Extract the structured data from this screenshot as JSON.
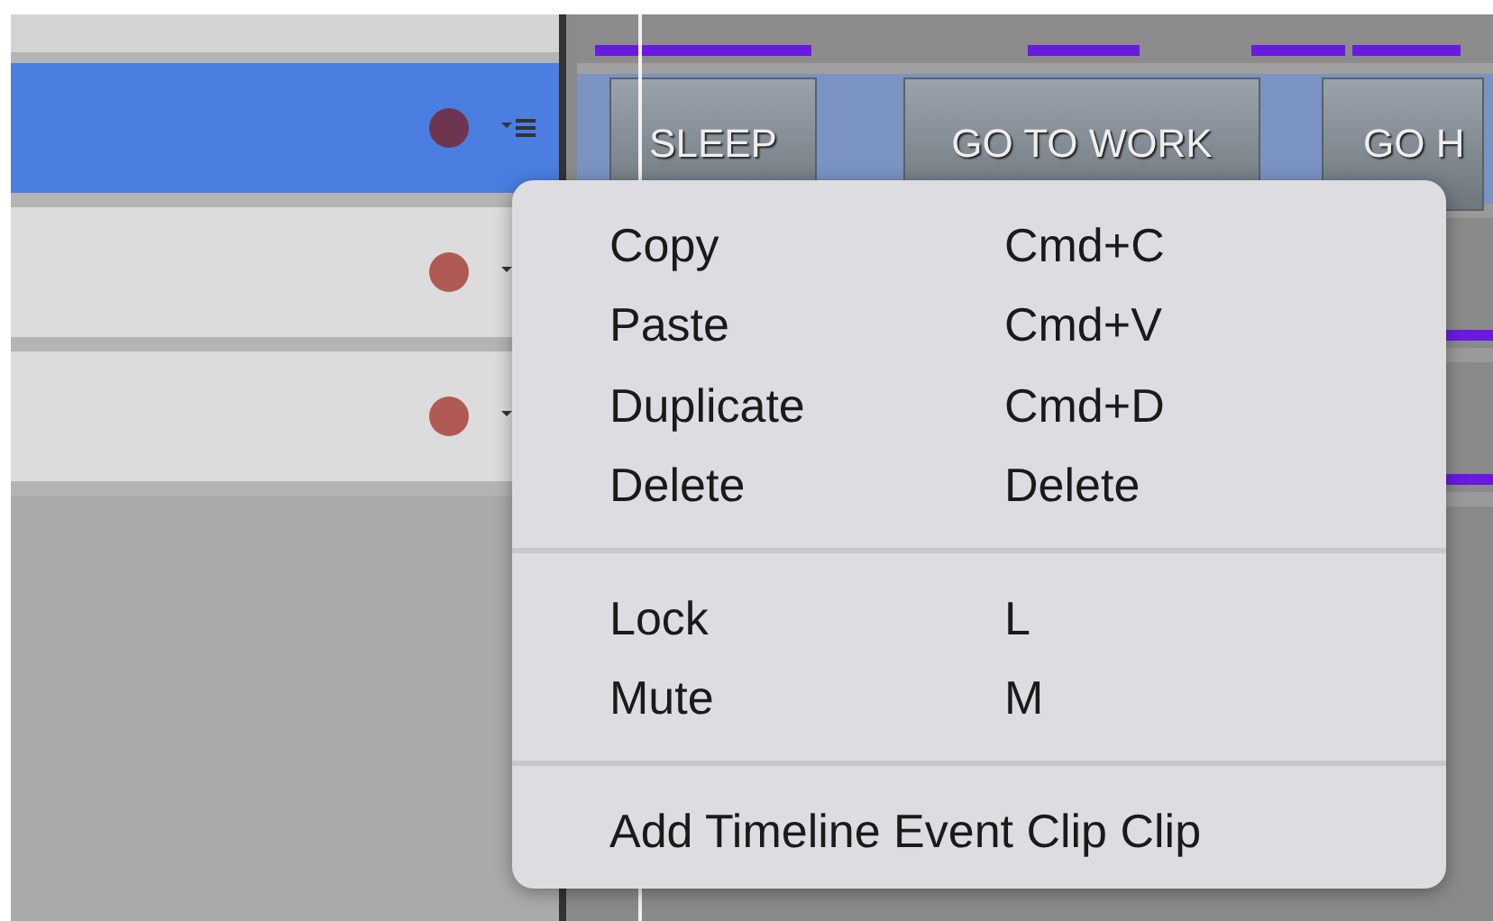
{
  "tracks": [
    {
      "selected": true,
      "color": "#6e3550"
    },
    {
      "selected": false,
      "color": "#b05a55"
    },
    {
      "selected": false,
      "color": "#b05a55"
    }
  ],
  "clips": [
    {
      "label": "SLEEP"
    },
    {
      "label": "GO TO WORK"
    },
    {
      "label": "GO H"
    }
  ],
  "context_menu": {
    "sections": [
      [
        {
          "label": "Copy",
          "shortcut": "Cmd+C"
        },
        {
          "label": "Paste",
          "shortcut": "Cmd+V"
        },
        {
          "label": "Duplicate",
          "shortcut": "Cmd+D"
        },
        {
          "label": "Delete",
          "shortcut": "Delete"
        }
      ],
      [
        {
          "label": "Lock",
          "shortcut": "L"
        },
        {
          "label": "Mute",
          "shortcut": "M"
        }
      ],
      [
        {
          "label": "Add Timeline Event Clip Clip"
        }
      ]
    ]
  }
}
